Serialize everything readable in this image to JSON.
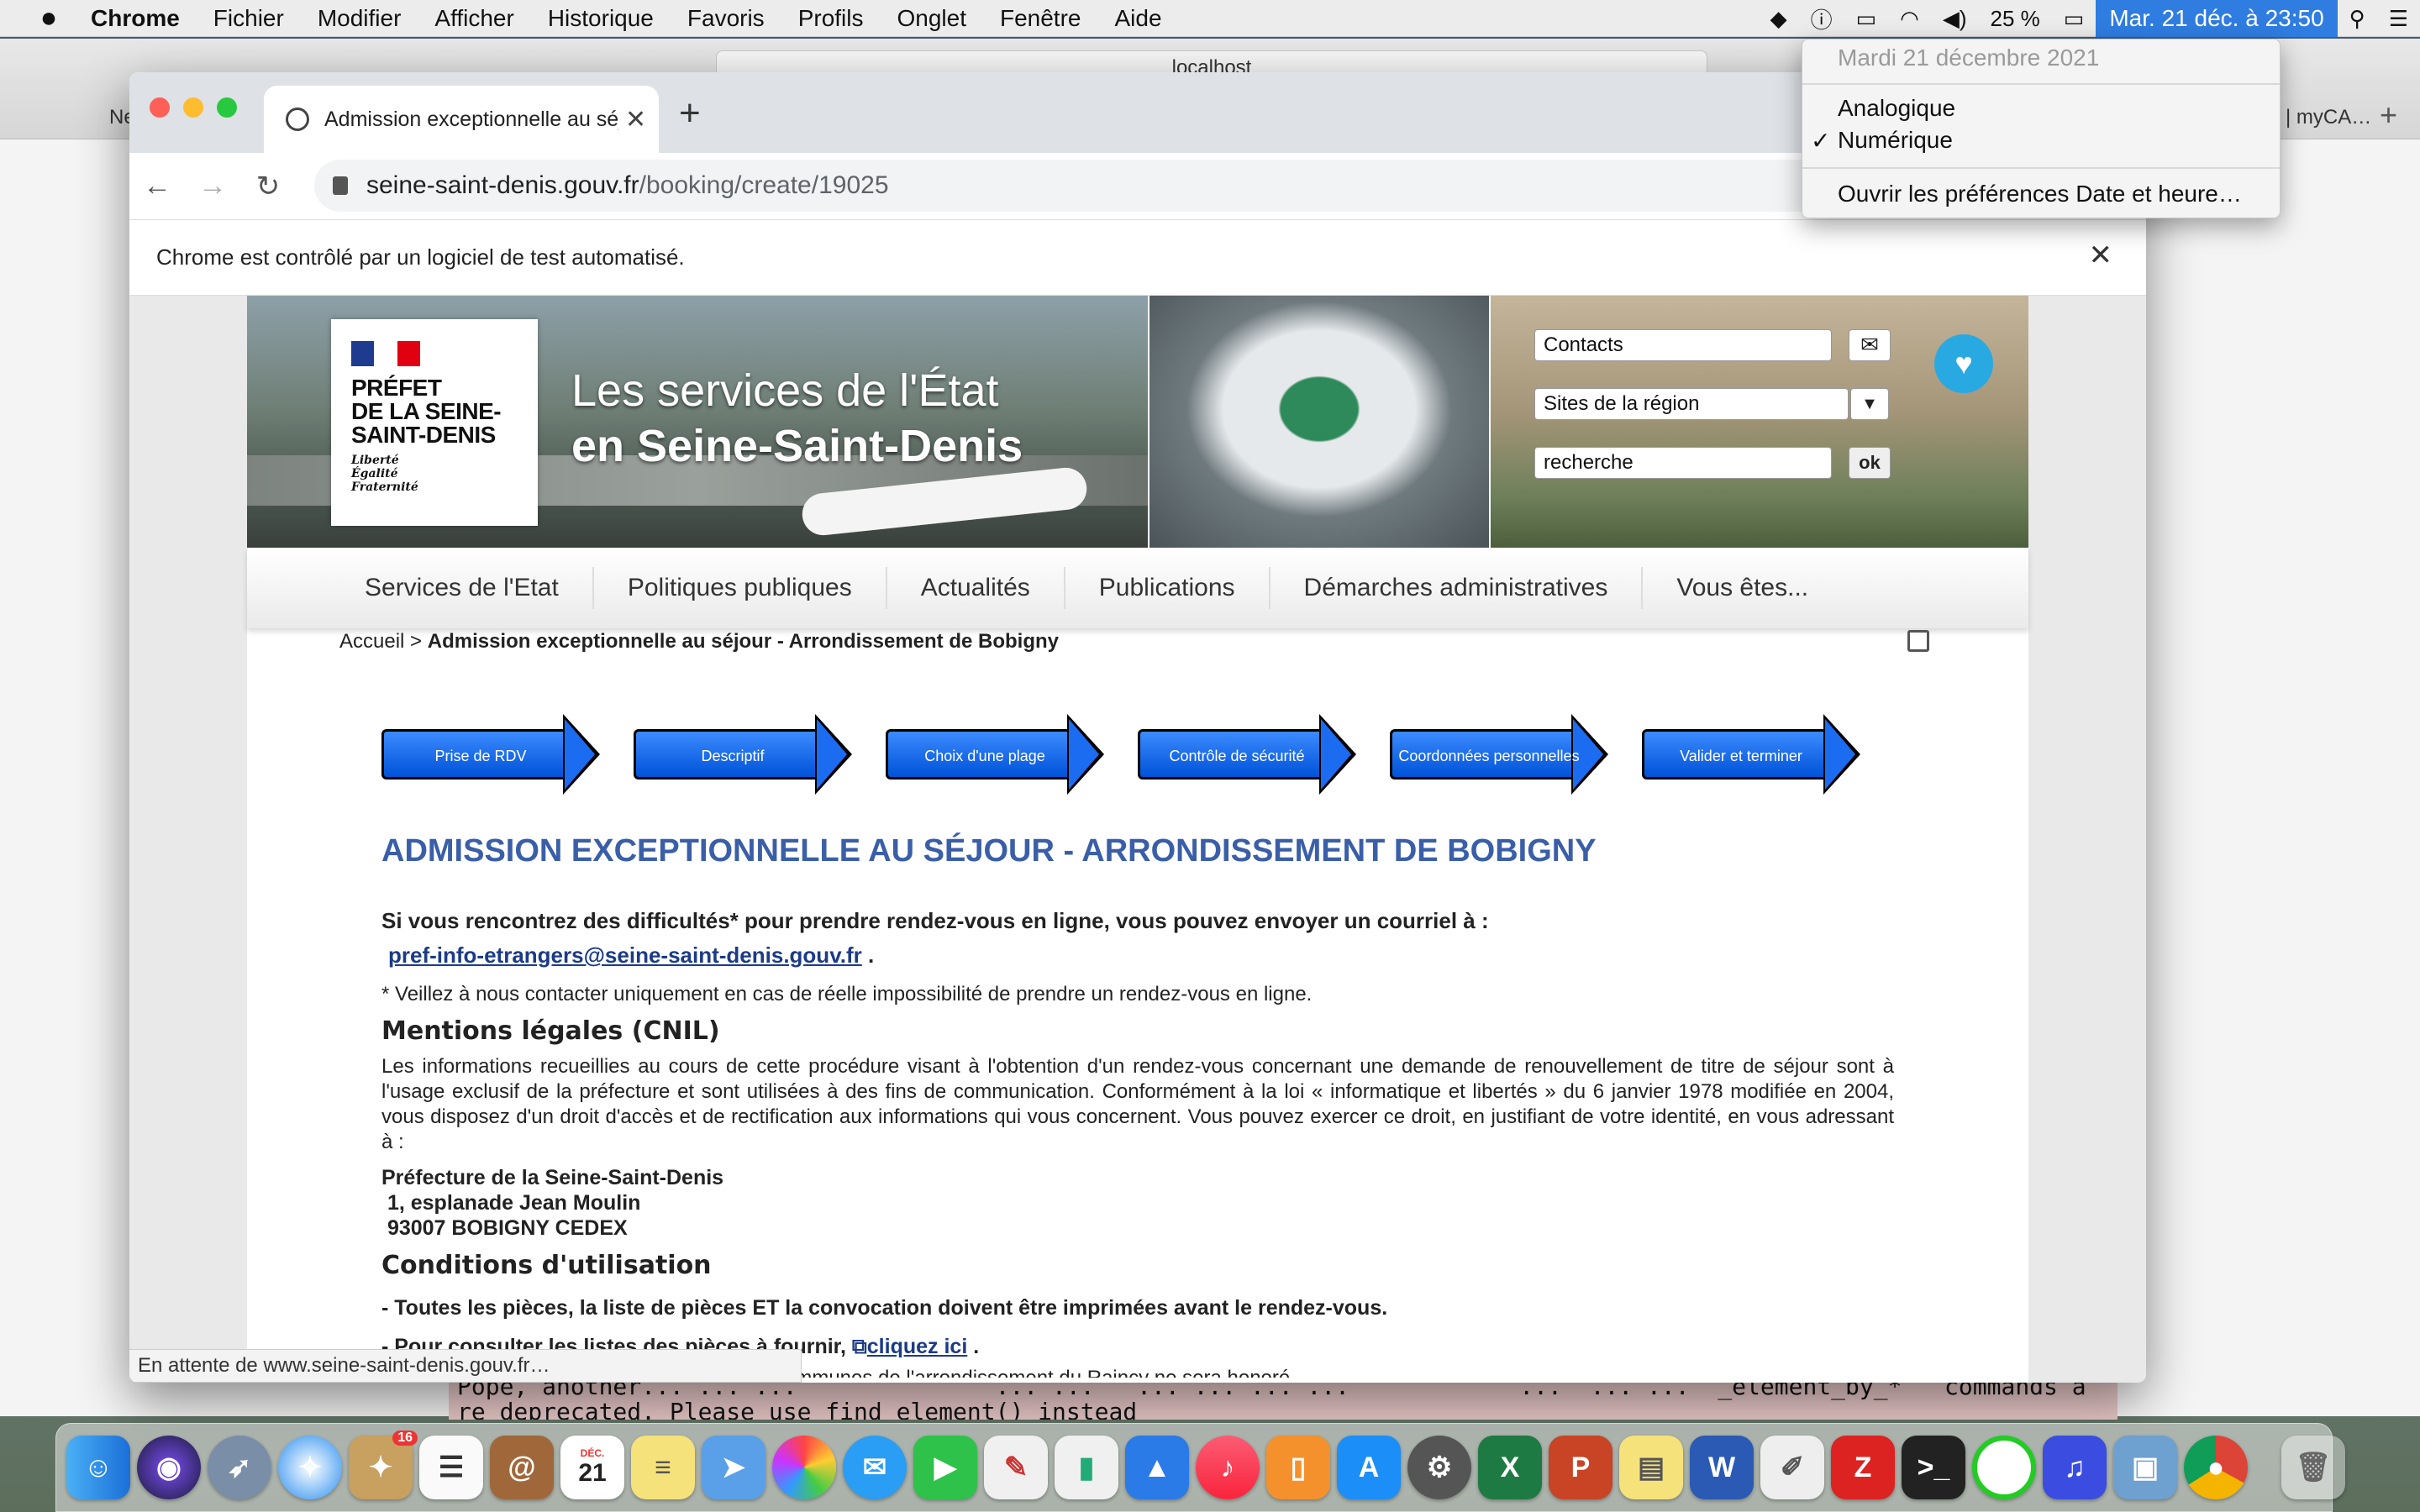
{
  "menubar": {
    "app_name": "Chrome",
    "items": [
      "Fichier",
      "Modifier",
      "Afficher",
      "Historique",
      "Favoris",
      "Profils",
      "Onglet",
      "Fenêtre",
      "Aide"
    ],
    "battery": "25 %",
    "clock": "Mar. 21 déc. à  23:50"
  },
  "date_menu": {
    "header": "Mardi 21 décembre 2021",
    "option_analog": "Analogique",
    "option_digital": "Numérique",
    "check": "✓",
    "prefs": "Ouvrir les préférences Date et heure…"
  },
  "background_window": {
    "url": "localhost",
    "tab_left": "Ne",
    "tab_right": "| myCA…",
    "terminal_line1": "Pope, another... ... ...              ... ...   ... ... ... ...            ...  ... ...  _element_by_*   commands a",
    "terminal_line2": "re deprecated. Please use find_element() instead"
  },
  "chrome": {
    "tab_title": "Admission exceptionnelle au séjour",
    "url_host": "seine-saint-denis.gouv.fr",
    "url_path": "/booking/create/19025",
    "infobar": "Chrome est contrôlé par un logiciel de test automatisé.",
    "status": "En attente de www.seine-saint-denis.gouv.fr…"
  },
  "site": {
    "logo_lines": [
      "PRÉFET",
      "DE LA SEINE-",
      "SAINT-DENIS"
    ],
    "motto": [
      "Liberté",
      "Égalité",
      "Fraternité"
    ],
    "banner_title_1": "Les services de l'État",
    "banner_title_2": "en Seine-Saint-Denis",
    "contacts_field": "Contacts",
    "sites_field": "Sites de la région",
    "search_field": "recherche",
    "ok_label": "ok",
    "nav": [
      "Services de l'Etat",
      "Politiques publiques",
      "Actualités",
      "Publications",
      "Démarches administratives",
      "Vous êtes..."
    ],
    "breadcrumb_home": "Accueil",
    "breadcrumb_sep": " > ",
    "breadcrumb_current": "Admission exceptionnelle au séjour - Arrondissement de Bobigny",
    "steps": [
      "Prise de RDV",
      "Descriptif",
      "Choix d'une plage",
      "Contrôle de sécurité",
      "Coordonnées personnelles",
      "Valider et terminer"
    ],
    "heading": "Admission exceptionnelle au séjour - Arrondissement de Bobigny",
    "difficulty_text": "Si vous rencontrez des difficultés* pour prendre rendez-vous en ligne, vous pouvez envoyer un courriel à :",
    "email": "pref-info-etrangers@seine-saint-denis.gouv.fr",
    "email_after": " .",
    "note": "* Veillez à nous contacter uniquement en cas de réelle impossibilité de prendre un rendez-vous en ligne.",
    "h_cnil": "Mentions légales (CNIL)",
    "cnil_text": "Les informations recueillies au cours de cette procédure visant à l'obtention d'un rendez-vous concernant une demande de renouvellement de titre de séjour sont à l'usage exclusif de la préfecture et sont utilisées à des fins de communication. Conformément à la loi « informatique et libertés » du 6 janvier 1978 modifiée en 2004, vous disposez d'un droit d'accès et de rectification aux informations qui vous concernent. Vous pouvez exercer ce droit, en justifiant de votre identité, en vous adressant à :",
    "address": [
      "Préfecture de la Seine-Saint-Denis",
      " 1, esplanade Jean Moulin",
      " 93007 BOBIGNY CEDEX"
    ],
    "h_conditions": "Conditions d'utilisation",
    "cond_1": "- Toutes les pièces, la liste de pièces ET la convocation doivent être imprimées avant le rendez-vous.",
    "cond_2_prefix": "- Pour consulter les listes des pièces à fournir, ",
    "cond_2_link": "cliquez ici",
    "cond_2_suffix": " .",
    "cond_3": "...ligne par des personnes habitant une des communes de l'arrondissement du Raincy ne sera honoré"
  },
  "dock": {
    "calendar_month": "DÉC.",
    "calendar_day": "21",
    "photos_badge": "16"
  }
}
